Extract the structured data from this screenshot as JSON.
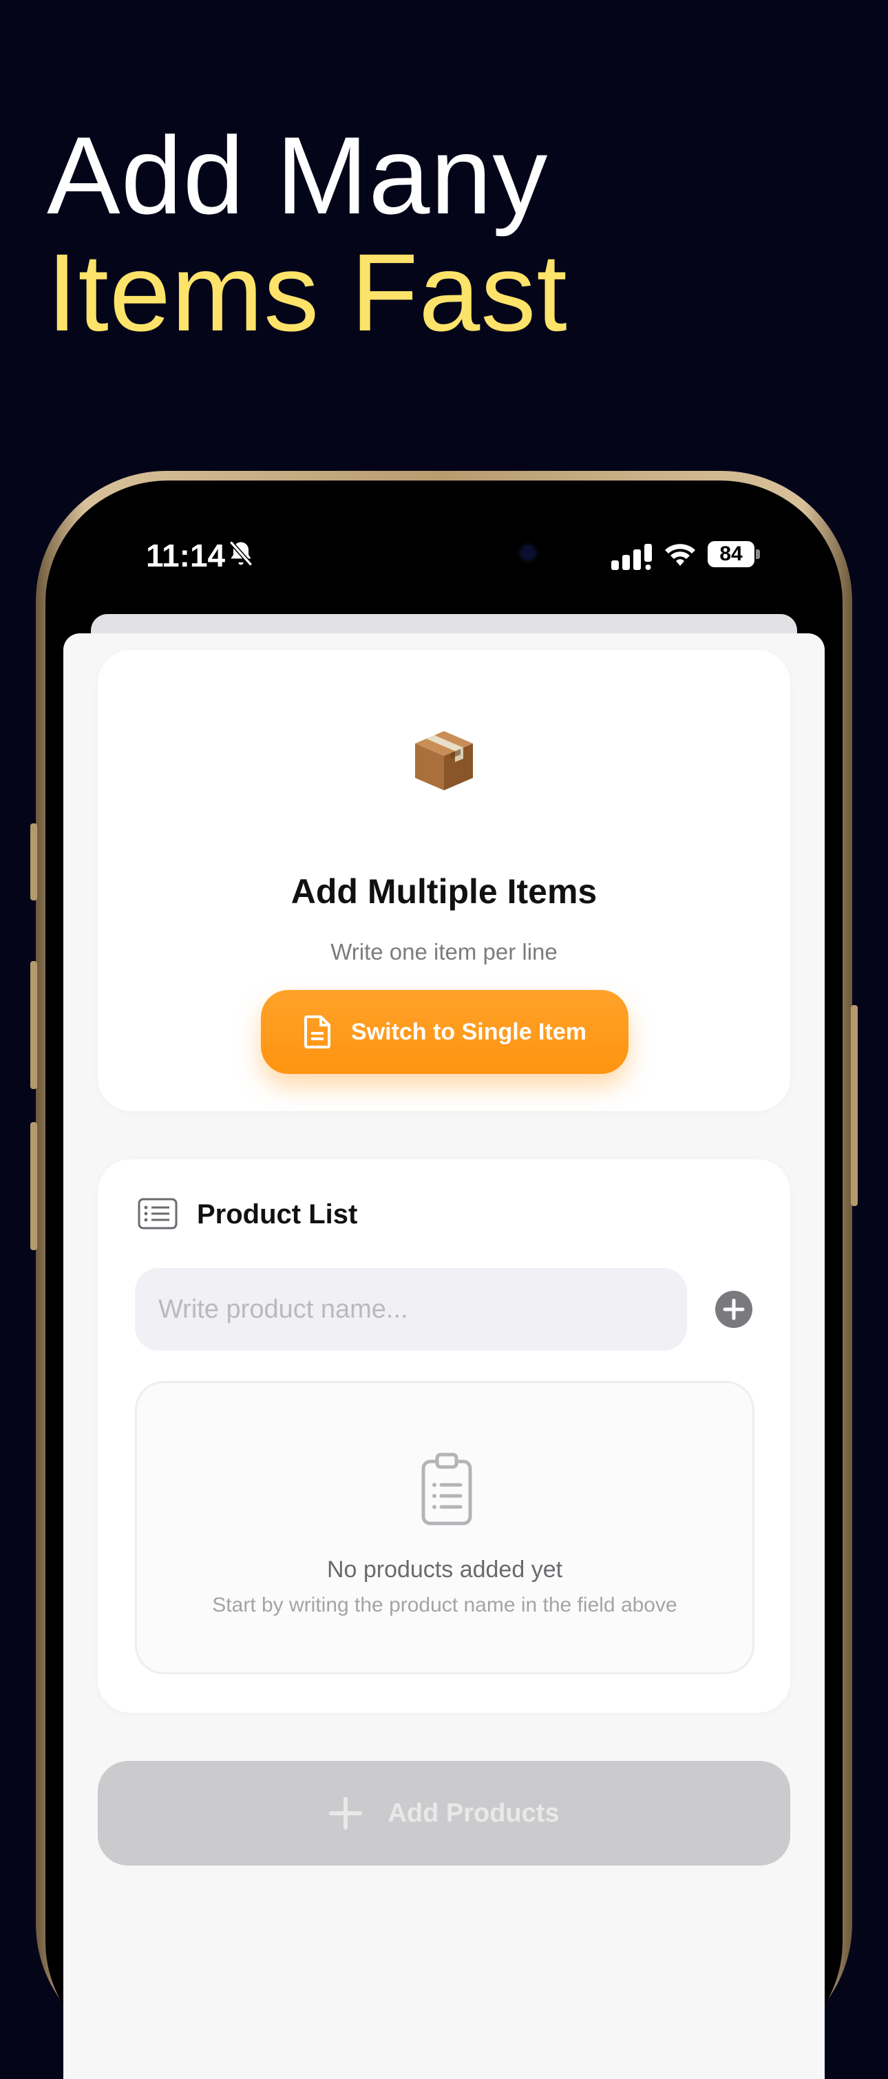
{
  "headline": {
    "line1": "Add Many",
    "line2": "Items Fast"
  },
  "status_bar": {
    "time": "11:14",
    "battery": "84"
  },
  "hero": {
    "icon": "package-emoji",
    "title": "Add Multiple Items",
    "subtitle": "Write one item per line",
    "switch_button": "Switch to Single Item"
  },
  "product_list": {
    "title": "Product List",
    "input_placeholder": "Write product name...",
    "empty_title": "No products added yet",
    "empty_subtitle": "Start by writing the product name in the field above"
  },
  "add_button": {
    "label": "Add Products"
  },
  "colors": {
    "background": "#05051a",
    "headline_accent": "#fde36a",
    "accent_orange": "#ff9a1c",
    "disabled_button": "#cbcbcd"
  }
}
